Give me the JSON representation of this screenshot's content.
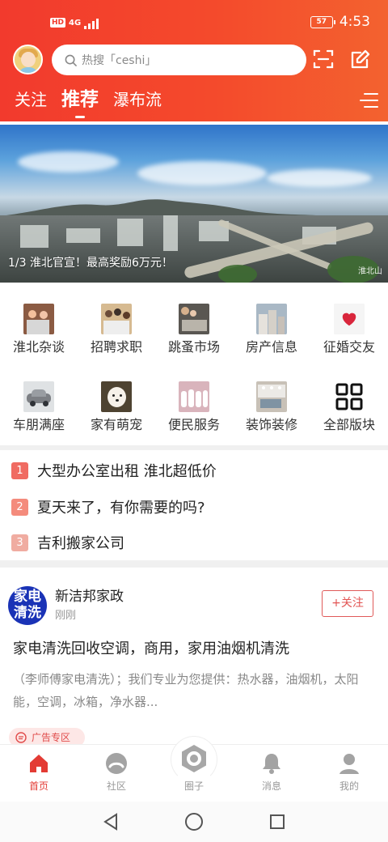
{
  "status": {
    "network": "HD",
    "signal": "4G",
    "battery": "57",
    "time": "4:53"
  },
  "header": {
    "search_placeholder": "热搜「ceshi」",
    "scan_icon": "scan-icon",
    "edit_icon": "edit-icon",
    "tabs": [
      {
        "label": "关注"
      },
      {
        "label": "推荐"
      },
      {
        "label": "瀑布流"
      }
    ],
    "menu_icon": "menu-icon"
  },
  "banner": {
    "caption": "1/3 淮北官宣！最高奖励6万元！",
    "watermark": "淮北山"
  },
  "categories": [
    {
      "label": "淮北杂谈",
      "icon": "people-photo-icon"
    },
    {
      "label": "招聘求职",
      "icon": "job-photo-icon"
    },
    {
      "label": "跳蚤市场",
      "icon": "market-photo-icon"
    },
    {
      "label": "房产信息",
      "icon": "building-photo-icon"
    },
    {
      "label": "征婚交友",
      "icon": "heart-photo-icon"
    },
    {
      "label": "车朋满座",
      "icon": "car-photo-icon"
    },
    {
      "label": "家有萌宠",
      "icon": "dog-photo-icon"
    },
    {
      "label": "便民服务",
      "icon": "service-photo-icon"
    },
    {
      "label": "装饰装修",
      "icon": "room-photo-icon"
    },
    {
      "label": "全部版块",
      "icon": "grid-icon"
    }
  ],
  "news": [
    {
      "rank": "1",
      "title": "大型办公室出租 淮北超低价",
      "color": "#f06b62"
    },
    {
      "rank": "2",
      "title": "夏天来了，有你需要的吗?",
      "color": "#f48b7c"
    },
    {
      "rank": "3",
      "title": "吉利搬家公司",
      "color": "#f0aca1"
    }
  ],
  "post": {
    "avatar_line1": "家电",
    "avatar_line2": "清洗",
    "author": "新洁邦家政",
    "time": "刚刚",
    "follow": "+关注",
    "title": "家电清洗回收空调，商用，家用油烟机清洗",
    "desc": "（李师傅家电清洗）；我们专业为您提供：热水器，油烟机，太阳能，空调，冰箱，净水器...",
    "ad": "广告专区"
  },
  "bottom_nav": [
    {
      "label": "首页",
      "icon": "home-icon"
    },
    {
      "label": "社区",
      "icon": "community-icon"
    },
    {
      "label": "圈子",
      "icon": "circle-icon"
    },
    {
      "label": "消息",
      "icon": "bell-icon"
    },
    {
      "label": "我的",
      "icon": "profile-icon"
    }
  ],
  "colors": {
    "brand": "#f23a2d",
    "accent": "#e33b34"
  }
}
